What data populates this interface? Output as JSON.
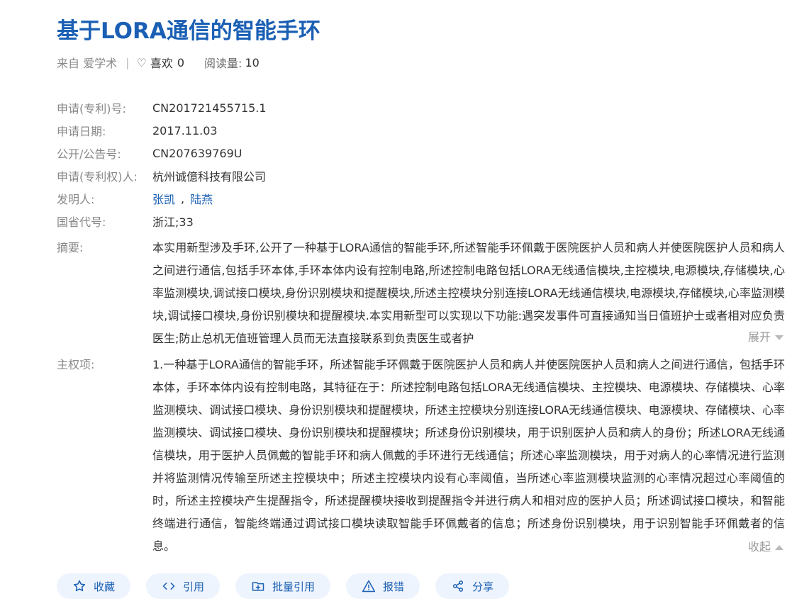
{
  "title": "基于LORA通信的智能手环",
  "meta": {
    "source": "来自 爱学术",
    "likes_label": "喜欢",
    "likes_count": "0",
    "reads_label": "阅读量:",
    "reads_count": "10"
  },
  "fields": [
    {
      "label": "申请(专利)号:",
      "value": "CN201721455715.1"
    },
    {
      "label": "申请日期:",
      "value": "2017.11.03"
    },
    {
      "label": "公开/公告号:",
      "value": "CN207639769U"
    },
    {
      "label": "申请(专利权)人:",
      "value": "杭州诚億科技有限公司"
    },
    {
      "label": "发明人:",
      "inventors": [
        "张凯",
        "陆燕"
      ],
      "separator": ","
    },
    {
      "label": "国省代号:",
      "value": "浙江;33"
    }
  ],
  "abstract": {
    "label": "摘要:",
    "text": "本实用新型涉及手环,公开了一种基于LORA通信的智能手环,所述智能手环佩戴于医院医护人员和病人并使医院医护人员和病人之间进行通信,包括手环本体,手环本体内设有控制电路,所述控制电路包括LORA无线通信模块,主控模块,电源模块,存储模块,心率监测模块,调试接口模块,身份识别模块和提醒模块,所述主控模块分别连接LORA无线通信模块,电源模块,存储模块,心率监测模块,调试接口模块,身份识别模块和提醒模块.本实用新型可以实现以下功能:遇突发事件可直接通知当日值班护士或者相对应负责医生;防止总机无值班管理人员而无法直接联系到负责医生或者护",
    "toggle": "展开"
  },
  "claim": {
    "label": "主权项:",
    "text": "1.一种基于LORA通信的智能手环，所述智能手环佩戴于医院医护人员和病人并使医院医护人员和病人之间进行通信，包括手环本体，手环本体内设有控制电路，其特征在于：所述控制电路包括LORA无线通信模块、主控模块、电源模块、存储模块、心率监测模块、调试接口模块、身份识别模块和提醒模块，所述主控模块分别连接LORA无线通信模块、电源模块、存储模块、心率监测模块、调试接口模块、身份识别模块和提醒模块；所述身份识别模块，用于识别医护人员和病人的身份；所述LORA无线通信模块，用于医护人员佩戴的智能手环和病人佩戴的手环进行无线通信；所述心率监测模块，用于对病人的心率情况进行监测并将监测情况传输至所述主控模块中；所述主控模块内设有心率阈值，当所述心率监测模块监测的心率情况超过心率阈值的时，所述主控模块产生提醒指令，所述提醒模块接收到提醒指令并进行病人和相对应的医护人员；所述调试接口模块，和智能终端进行通信，智能终端通过调试接口模块读取智能手环佩戴者的信息；所述身份识别模块，用于识别智能手环佩戴者的信息。",
    "toggle": "收起"
  },
  "actions": [
    {
      "label": "收藏",
      "icon": "star-icon"
    },
    {
      "label": "引用",
      "icon": "code-icon"
    },
    {
      "label": "批量引用",
      "icon": "folder-add-icon"
    },
    {
      "label": "报错",
      "icon": "warning-icon"
    },
    {
      "label": "分享",
      "icon": "share-icon"
    }
  ],
  "colors": {
    "title": "#1a5fb4",
    "link": "#1a5fb4",
    "button_bg": "#eef4fd",
    "label": "#888888"
  }
}
